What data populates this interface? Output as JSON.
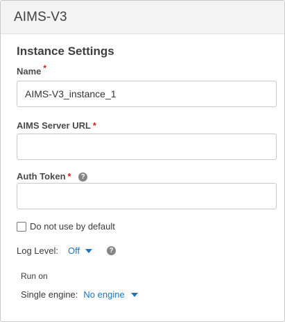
{
  "header": {
    "title": "AIMS-V3"
  },
  "section": {
    "title": "Instance Settings"
  },
  "fields": {
    "name": {
      "label": "Name",
      "required_mark": "*",
      "value": "AIMS-V3_instance_1"
    },
    "server_url": {
      "label": "AIMS Server URL",
      "required_mark": "*",
      "value": ""
    },
    "auth_token": {
      "label": "Auth Token",
      "required_mark": "*",
      "help_icon": "question-circle-icon",
      "value": ""
    }
  },
  "default_checkbox": {
    "label": "Do not use by default",
    "checked": false
  },
  "log_level": {
    "label": "Log Level:",
    "value": "Off",
    "help_icon": "question-circle-icon"
  },
  "run_on": {
    "label": "Run on",
    "engine_label": "Single engine:",
    "engine_value": "No engine"
  },
  "colors": {
    "accent": "#1c75bb",
    "required": "#d0211c",
    "header_bg": "#f3f3f3"
  }
}
